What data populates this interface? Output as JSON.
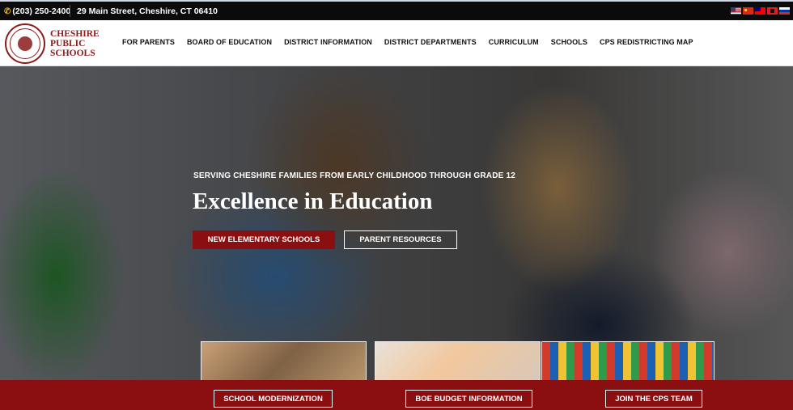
{
  "utility_bar": {
    "phone": "(203) 250-2400",
    "address": "29 Main Street, Cheshire, CT 06410",
    "flags": [
      "us-flag-icon",
      "cn-flag-icon",
      "tw-flag-icon",
      "al-flag-icon",
      "ru-flag-icon"
    ]
  },
  "logo": {
    "line1": "CHESHIRE",
    "line2": "PUBLIC",
    "line3": "SCHOOLS",
    "color": "#8b1a1a"
  },
  "nav": {
    "items": [
      "FOR PARENTS",
      "BOARD OF EDUCATION",
      "DISTRICT INFORMATION",
      "DISTRICT DEPARTMENTS",
      "CURRICULUM",
      "SCHOOLS",
      "CPS REDISTRICTING MAP"
    ]
  },
  "hero": {
    "eyebrow": "SERVING CHESHIRE FAMILIES FROM EARLY CHILDHOOD THROUGH GRADE 12",
    "title": "Excellence in Education",
    "primary_button": "NEW ELEMENTARY SCHOOLS",
    "secondary_button": "PARENT RESOURCES"
  },
  "bottom_bar": {
    "buttons": [
      "SCHOOL MODERNIZATION",
      "BOE BUDGET INFORMATION",
      "JOIN THE CPS TEAM"
    ]
  },
  "colors": {
    "brand": "#8b0f10",
    "topbar": "#0b0b0b",
    "phone_icon": "#e0b020"
  }
}
